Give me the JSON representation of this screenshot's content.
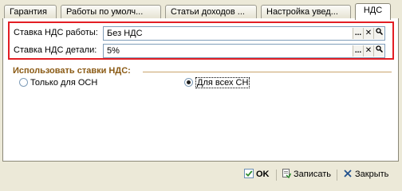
{
  "tabs": [
    {
      "label": "Гарантия",
      "active": false
    },
    {
      "label": "Работы по умолч...",
      "active": false
    },
    {
      "label": "Статьи доходов ...",
      "active": false
    },
    {
      "label": "Настройка увед...",
      "active": false
    },
    {
      "label": "НДС",
      "active": true
    }
  ],
  "vat": {
    "work_label": "Ставка НДС работы:",
    "work_value": "Без НДС",
    "part_label": "Ставка НДС детали:",
    "part_value": "5%",
    "select_glyph": "...",
    "clear_glyph": "✕",
    "search_glyph": "🔍"
  },
  "use_rates": {
    "title": "Использовать ставки НДС:",
    "option_osn": "Только для ОСН",
    "option_all": "Для всех СН",
    "selected": "option_all"
  },
  "footer": {
    "ok_label": "OK",
    "save_label": "Записать",
    "close_label": "Закрыть"
  },
  "colors": {
    "highlight_border": "#e31e24",
    "section_title": "#8a5a14"
  }
}
